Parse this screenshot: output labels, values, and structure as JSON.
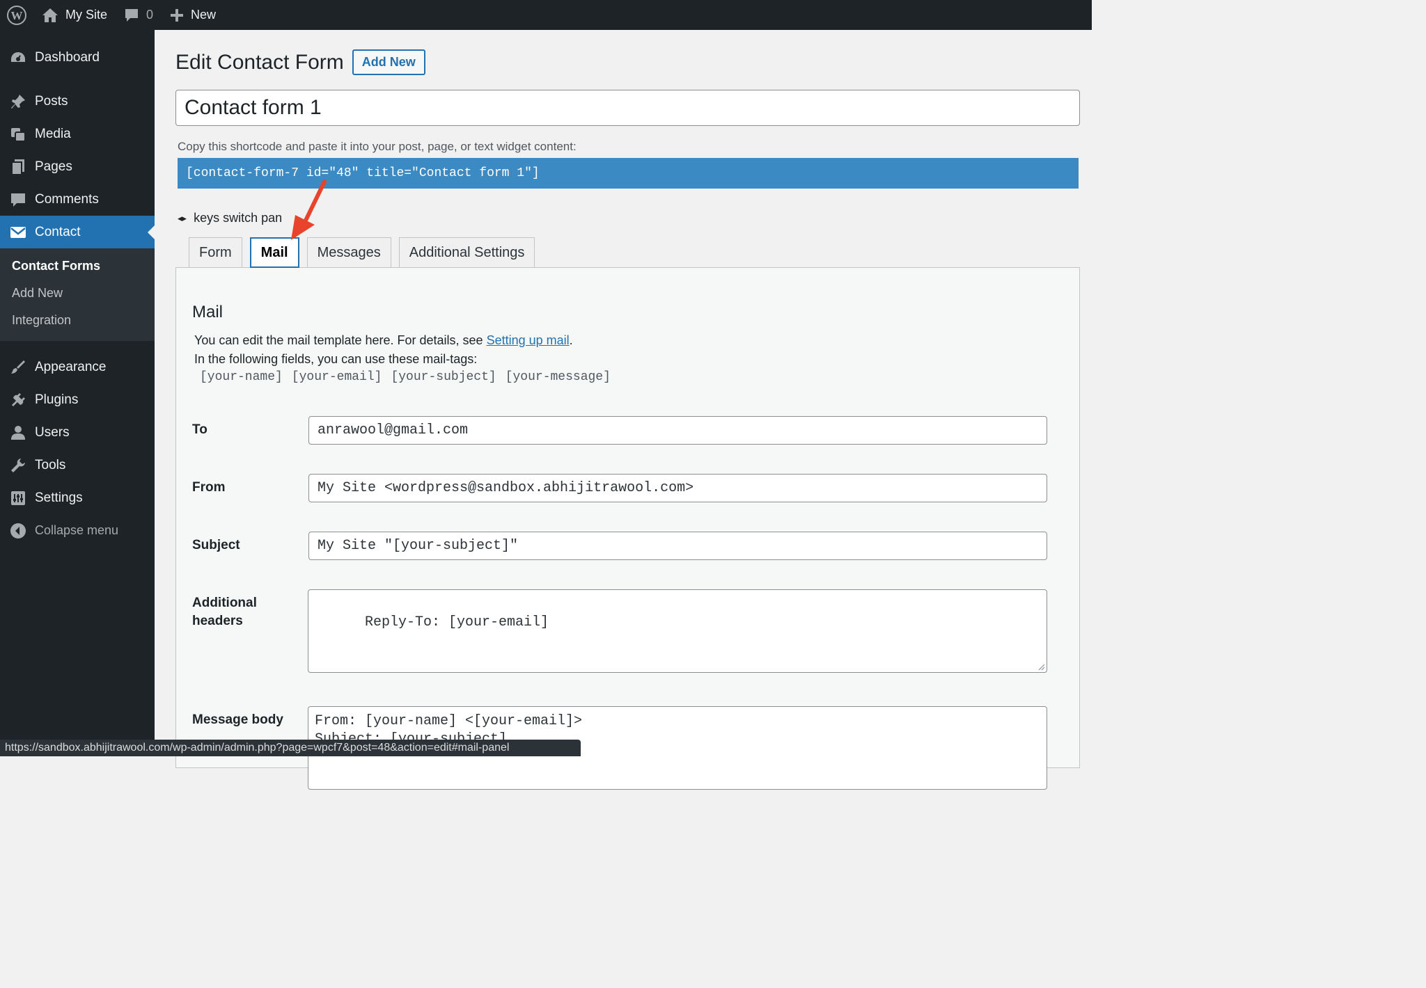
{
  "adminbar": {
    "site_name": "My Site",
    "comments_count": "0",
    "new_label": "New"
  },
  "sidebar": {
    "items_top": [
      {
        "label": "Dashboard",
        "icon": "dashboard-icon"
      }
    ],
    "items_main": [
      {
        "label": "Posts",
        "icon": "pushpin-icon"
      },
      {
        "label": "Media",
        "icon": "media-icon"
      },
      {
        "label": "Pages",
        "icon": "pages-icon"
      },
      {
        "label": "Comments",
        "icon": "comments-icon"
      }
    ],
    "current": {
      "label": "Contact",
      "icon": "envelope-icon"
    },
    "submenu": [
      "Contact Forms",
      "Add New",
      "Integration"
    ],
    "items_bottom": [
      {
        "label": "Appearance",
        "icon": "paintbrush-icon"
      },
      {
        "label": "Plugins",
        "icon": "plugin-icon"
      },
      {
        "label": "Users",
        "icon": "users-icon"
      },
      {
        "label": "Tools",
        "icon": "wrench-icon"
      },
      {
        "label": "Settings",
        "icon": "settings-icon"
      }
    ],
    "collapse_label": "Collapse menu"
  },
  "page": {
    "title": "Edit Contact Form",
    "add_new": "Add New",
    "form_title": "Contact form 1",
    "shortcode_label": "Copy this shortcode and paste it into your post, page, or text widget content:",
    "shortcode": "[contact-form-7 id=\"48\" title=\"Contact form 1\"]",
    "keys_hint": "keys switch pan"
  },
  "tabs": [
    "Form",
    "Mail",
    "Messages",
    "Additional Settings"
  ],
  "mail_panel": {
    "heading": "Mail",
    "desc_prefix": "You can edit the mail template here. For details, see ",
    "desc_link": "Setting up mail",
    "desc_suffix": ".",
    "tags_intro": "In the following fields, you can use these mail-tags:",
    "mail_tags": [
      "[your-name]",
      "[your-email]",
      "[your-subject]",
      "[your-message]"
    ],
    "fields": {
      "to_label": "To",
      "to_value": "anrawool@gmail.com",
      "from_label": "From",
      "from_value": "My Site <wordpress@sandbox.abhijitrawool.com>",
      "subject_label": "Subject",
      "subject_value": "My Site \"[your-subject]\"",
      "headers_label_1": "Additional",
      "headers_label_2": "headers",
      "headers_value": "Reply-To: [your-email]",
      "body_label": "Message body",
      "body_value": "From: [your-name] <[your-email]>\nSubject: [your-subject]"
    }
  },
  "status_url": "https://sandbox.abhijitrawool.com/wp-admin/admin.php?page=wpcf7&post=48&action=edit#mail-panel",
  "colors": {
    "admin_bg": "#1d2327",
    "accent": "#2271b1",
    "shortcode_bg": "#3c8ac3",
    "annotation_arrow": "#e8432c"
  }
}
